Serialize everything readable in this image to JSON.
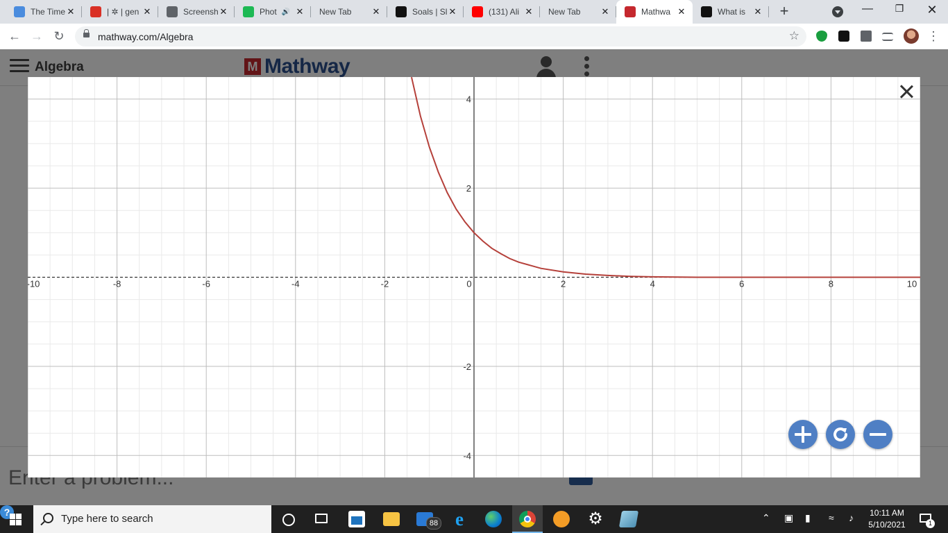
{
  "browser": {
    "tabs": [
      {
        "title": "The Time",
        "favicon": "document-icon",
        "color": "#4a8cde",
        "active": false
      },
      {
        "title": "| ✲ | gen",
        "favicon": "recording-icon",
        "color": "#d93025",
        "active": false
      },
      {
        "title": "Screensh",
        "favicon": "globe-icon",
        "color": "#5f6368",
        "active": false
      },
      {
        "title": "Phot",
        "favicon": "spotify-icon",
        "color": "#1db954",
        "active": false,
        "audio": true
      },
      {
        "title": "New Tab",
        "favicon": "",
        "color": "",
        "active": false
      },
      {
        "title": "Soals | Sl",
        "favicon": "v-logo-icon",
        "color": "#111111",
        "active": false
      },
      {
        "title": "(131) Ali",
        "favicon": "youtube-icon",
        "color": "#ff0000",
        "active": false
      },
      {
        "title": "New Tab",
        "favicon": "",
        "color": "",
        "active": false
      },
      {
        "title": "Mathwa",
        "favicon": "mathway-icon",
        "color": "#c5282e",
        "active": true
      },
      {
        "title": "What is",
        "favicon": "b-logo-icon",
        "color": "#111111",
        "active": false
      }
    ],
    "url": "mathway.com/Algebra"
  },
  "page": {
    "section_title": "Algebra",
    "logo_text": "Mathway",
    "logo_mark": "M",
    "problem_placeholder": "Enter a problem..."
  },
  "chart_data": {
    "type": "line",
    "title": "",
    "xlabel": "",
    "ylabel": "",
    "xlim": [
      -10,
      10
    ],
    "ylim": [
      -4.5,
      4.5
    ],
    "xticks": [
      -10,
      -8,
      -6,
      -4,
      -2,
      0,
      2,
      4,
      6,
      8,
      10
    ],
    "yticks": [
      -4,
      -2,
      2,
      4
    ],
    "grid": true,
    "curve_color": "#b5403a",
    "series": [
      {
        "x": [
          -1.4,
          -1.2,
          -1.0,
          -0.8,
          -0.6,
          -0.4,
          -0.2,
          0,
          0.2,
          0.4,
          0.6,
          0.8,
          1.0,
          1.25,
          1.5,
          2,
          2.5,
          3,
          3.5,
          4,
          5,
          6,
          7,
          8,
          9,
          10
        ],
        "y": [
          4.49,
          3.62,
          2.92,
          2.36,
          1.9,
          1.53,
          1.24,
          1.0,
          0.81,
          0.65,
          0.53,
          0.42,
          0.34,
          0.27,
          0.2,
          0.12,
          0.07,
          0.04,
          0.02,
          0.01,
          0.0,
          0.0,
          0.0,
          0.0,
          0.0,
          0.0
        ]
      }
    ],
    "asymptote_y": 0
  },
  "taskbar": {
    "search_placeholder": "Type here to search",
    "mail_badge": "88",
    "time": "10:11 AM",
    "date": "5/10/2021",
    "notification_count": "1"
  }
}
